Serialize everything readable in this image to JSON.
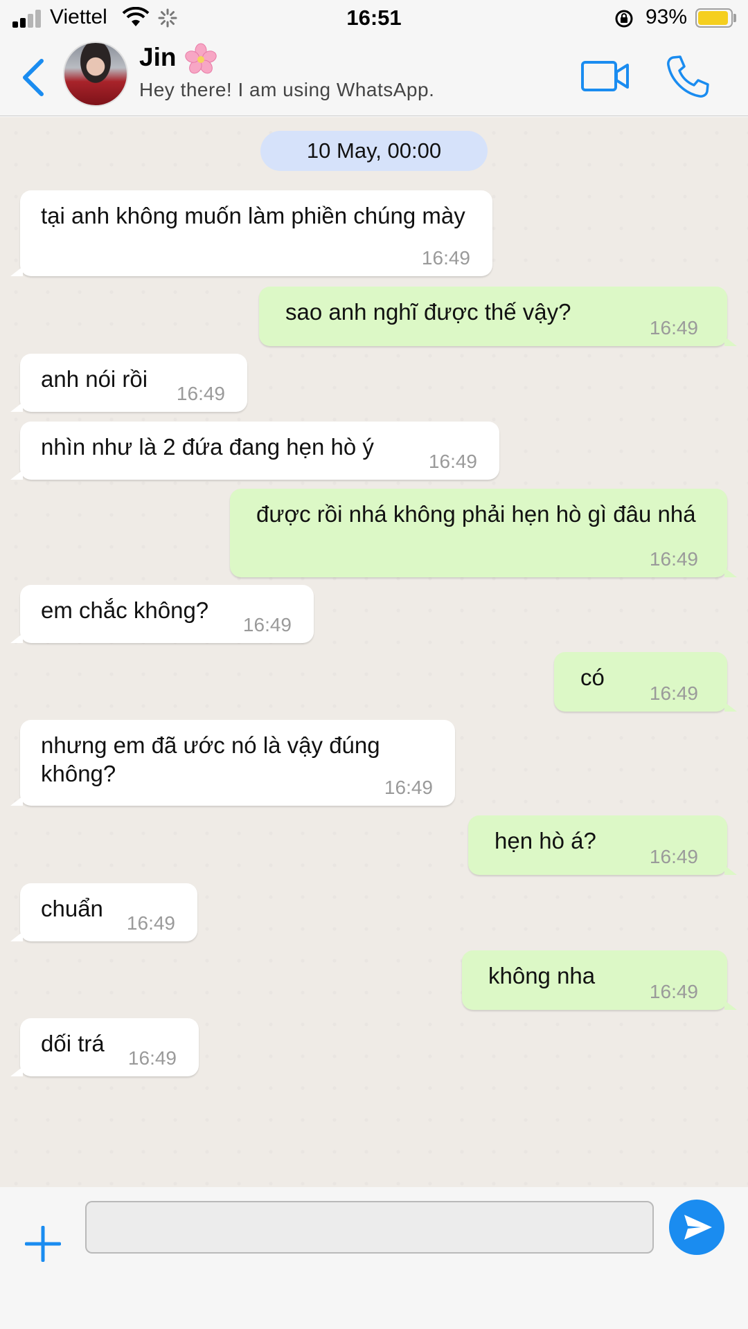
{
  "status_bar": {
    "carrier": "Viettel",
    "time": "16:51",
    "battery_percent": "93%",
    "signal_bars_active": 2,
    "signal_bars_total": 4,
    "battery_level": 0.93,
    "battery_color": "#f5cf1f"
  },
  "header": {
    "contact_name": "Jin",
    "contact_emoji_icon": "cherry-blossom-icon",
    "contact_status": "Hey there! I am using WhatsApp.",
    "accent_color": "#1a8cf0"
  },
  "chat": {
    "date_label": "10 May, 00:00",
    "incoming_bubble_color": "#ffffff",
    "outgoing_bubble_color": "#dcf8c6",
    "messages": [
      {
        "direction": "in",
        "text": "tại anh không muốn làm phiền chúng mày",
        "time": "16:49"
      },
      {
        "direction": "out",
        "text": "sao anh nghĩ được thế vậy?",
        "time": "16:49"
      },
      {
        "direction": "in",
        "text": "anh nói rồi",
        "time": "16:49"
      },
      {
        "direction": "in",
        "text": "nhìn như là 2 đứa đang hẹn hò ý",
        "time": "16:49"
      },
      {
        "direction": "out",
        "text": "được rồi nhá không phải hẹn hò gì đâu nhá",
        "time": "16:49"
      },
      {
        "direction": "in",
        "text": "em chắc không?",
        "time": "16:49"
      },
      {
        "direction": "out",
        "text": "có",
        "time": "16:49"
      },
      {
        "direction": "in",
        "text": "nhưng em đã ước nó là vậy đúng không?",
        "time": "16:49"
      },
      {
        "direction": "out",
        "text": "hẹn hò á?",
        "time": "16:49"
      },
      {
        "direction": "in",
        "text": "chuẩn",
        "time": "16:49"
      },
      {
        "direction": "out",
        "text": "không nha",
        "time": "16:49"
      },
      {
        "direction": "in",
        "text": "dối trá",
        "time": "16:49"
      }
    ]
  },
  "input_bar": {
    "message_value": "",
    "icons": [
      "plus-icon",
      "send-icon"
    ]
  }
}
